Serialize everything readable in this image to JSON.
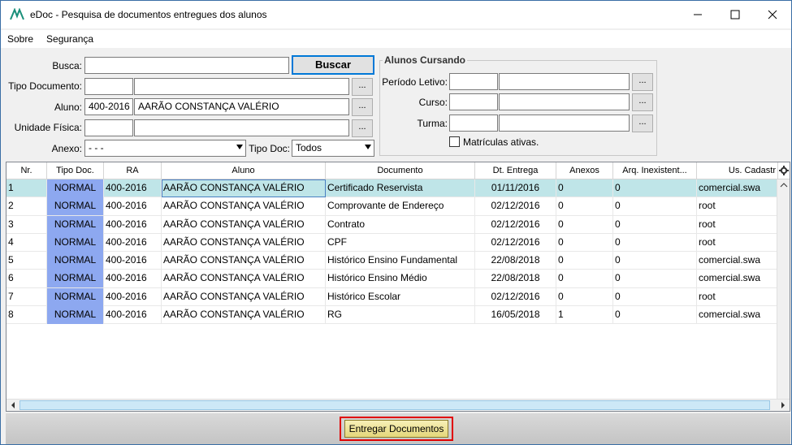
{
  "window": {
    "title": "eDoc - Pesquisa de documentos entregues dos alunos",
    "min_glyph": "—",
    "max_glyph": "☐",
    "close_glyph": "✕"
  },
  "menu": {
    "items": [
      {
        "label": "Sobre"
      },
      {
        "label": "Segurança"
      }
    ]
  },
  "form": {
    "busca_label": "Busca:",
    "busca_value": "",
    "buscar_button": "Buscar",
    "tipo_documento_label": "Tipo Documento:",
    "tipo_documento_code": "",
    "tipo_documento_name": "",
    "aluno_label": "Aluno:",
    "aluno_code": "400-2016",
    "aluno_name": "AARÃO CONSTANÇA VALÉRIO",
    "unidade_label": "Unidade Física:",
    "unidade_code": "",
    "unidade_name": "",
    "anexo_label": "Anexo:",
    "anexo_value": "- - -",
    "tipo_doc_label": "Tipo Doc:",
    "tipo_doc_value": "Todos",
    "dots": "..."
  },
  "alunos_cursando": {
    "title": "Alunos Cursando",
    "periodo_label": "Período Letivo:",
    "curso_label": "Curso:",
    "turma_label": "Turma:",
    "matriculas_label": "Matrículas ativas."
  },
  "grid": {
    "headers": [
      "Nr.",
      "Tipo Doc.",
      "RA",
      "Aluno",
      "Documento",
      "Dt. Entrega",
      "Anexos",
      "Arq. Inexistent...",
      "Us. Cadastr"
    ],
    "rows": [
      {
        "nr": "1",
        "tipo": "NORMAL",
        "ra": "400-2016",
        "aluno": "AARÃO CONSTANÇA VALÉRIO",
        "documento": "Certificado Reservista",
        "dt": "01/11/2016",
        "anexos": "0",
        "arq": "0",
        "us": "comercial.swa"
      },
      {
        "nr": "2",
        "tipo": "NORMAL",
        "ra": "400-2016",
        "aluno": "AARÃO CONSTANÇA VALÉRIO",
        "documento": "Comprovante de Endereço",
        "dt": "02/12/2016",
        "anexos": "0",
        "arq": "0",
        "us": "root"
      },
      {
        "nr": "3",
        "tipo": "NORMAL",
        "ra": "400-2016",
        "aluno": "AARÃO CONSTANÇA VALÉRIO",
        "documento": "Contrato",
        "dt": "02/12/2016",
        "anexos": "0",
        "arq": "0",
        "us": "root"
      },
      {
        "nr": "4",
        "tipo": "NORMAL",
        "ra": "400-2016",
        "aluno": "AARÃO CONSTANÇA VALÉRIO",
        "documento": "CPF",
        "dt": "02/12/2016",
        "anexos": "0",
        "arq": "0",
        "us": "root"
      },
      {
        "nr": "5",
        "tipo": "NORMAL",
        "ra": "400-2016",
        "aluno": "AARÃO CONSTANÇA VALÉRIO",
        "documento": "Histórico Ensino Fundamental",
        "dt": "22/08/2018",
        "anexos": "0",
        "arq": "0",
        "us": "comercial.swa"
      },
      {
        "nr": "6",
        "tipo": "NORMAL",
        "ra": "400-2016",
        "aluno": "AARÃO CONSTANÇA VALÉRIO",
        "documento": "Histórico Ensino Médio",
        "dt": "22/08/2018",
        "anexos": "0",
        "arq": "0",
        "us": "comercial.swa"
      },
      {
        "nr": "7",
        "tipo": "NORMAL",
        "ra": "400-2016",
        "aluno": "AARÃO CONSTANÇA VALÉRIO",
        "documento": "Histórico Escolar",
        "dt": "02/12/2016",
        "anexos": "0",
        "arq": "0",
        "us": "root"
      },
      {
        "nr": "8",
        "tipo": "NORMAL",
        "ra": "400-2016",
        "aluno": "AARÃO CONSTANÇA VALÉRIO",
        "documento": "RG",
        "dt": "16/05/2018",
        "anexos": "1",
        "arq": "0",
        "us": "comercial.swa"
      }
    ]
  },
  "footer": {
    "entregar_button": "Entregar Documentos"
  },
  "colors": {
    "tipo_cell": "#8da8f0",
    "selected_row": "#bfe5e8",
    "highlight_border": "#e00000"
  }
}
